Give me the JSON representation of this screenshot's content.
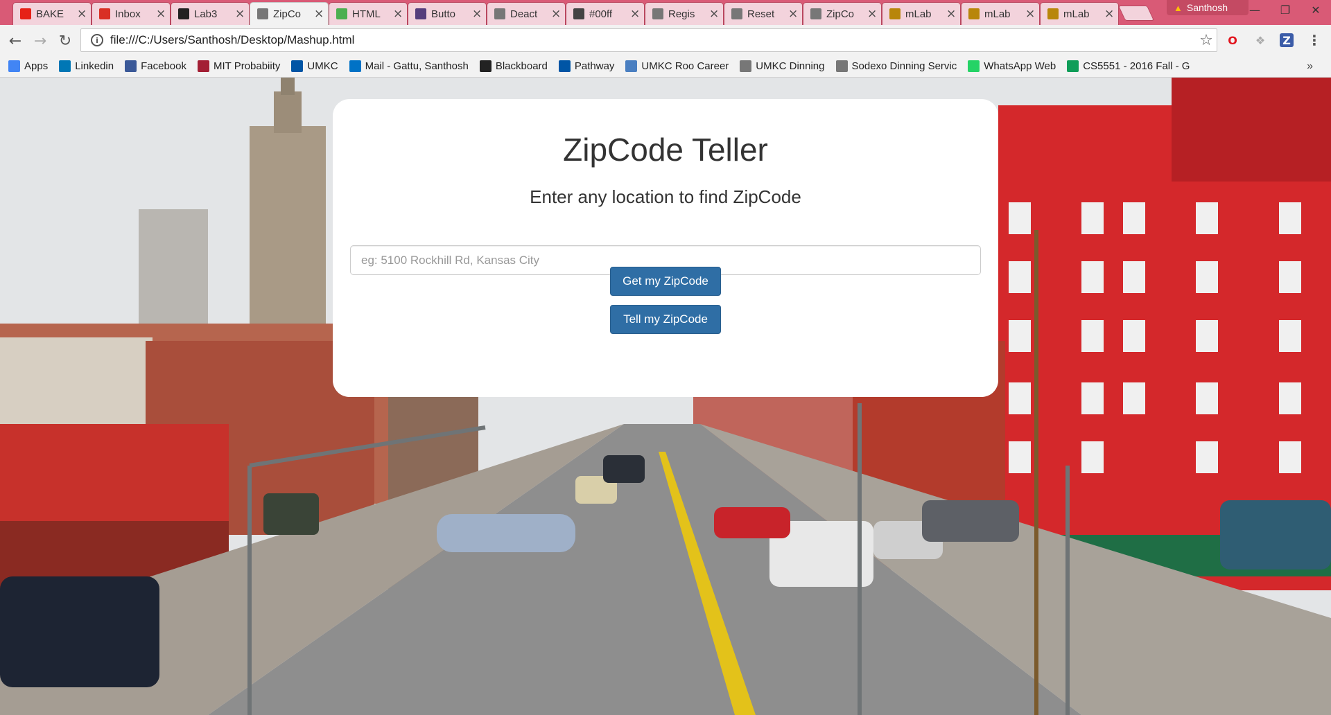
{
  "browser": {
    "tabs": [
      {
        "title": "BAKE",
        "favicon": "youtube-icon",
        "color": "#e62117"
      },
      {
        "title": "Inbox",
        "favicon": "gmail-icon",
        "color": "#d93025"
      },
      {
        "title": "Lab3",
        "favicon": "github-icon",
        "color": "#222222"
      },
      {
        "title": "ZipCo",
        "favicon": "page-icon",
        "color": "#777777",
        "active": true
      },
      {
        "title": "HTML",
        "favicon": "w3schools-icon",
        "color": "#4caf50"
      },
      {
        "title": "Butto",
        "favicon": "bootstrap-icon",
        "color": "#563d7c"
      },
      {
        "title": "Deact",
        "favicon": "page-icon",
        "color": "#777777"
      },
      {
        "title": "#00ff",
        "favicon": "color-icon",
        "color": "#444444"
      },
      {
        "title": "Regis",
        "favicon": "page-icon",
        "color": "#777777"
      },
      {
        "title": "Reset",
        "favicon": "page-icon",
        "color": "#777777"
      },
      {
        "title": "ZipCo",
        "favicon": "page-icon",
        "color": "#777777"
      },
      {
        "title": "mLab",
        "favicon": "mlab-icon",
        "color": "#b8860b"
      },
      {
        "title": "mLab",
        "favicon": "mlab-icon",
        "color": "#b8860b"
      },
      {
        "title": "mLab",
        "favicon": "mlab-icon",
        "color": "#b8860b"
      }
    ],
    "profile_name": "Santhosh",
    "url": "file:///C:/Users/Santhosh/Desktop/Mashup.html",
    "accent_color": "#d95a76"
  },
  "bookmarks": [
    {
      "label": "Apps",
      "icon": "apps-grid-icon",
      "color": "#4285f4"
    },
    {
      "label": "Linkedin",
      "icon": "linkedin-icon",
      "color": "#0077b5"
    },
    {
      "label": "Facebook",
      "icon": "facebook-icon",
      "color": "#3b5998"
    },
    {
      "label": "MIT Probabiity",
      "icon": "mit-ocw-icon",
      "color": "#a31f34"
    },
    {
      "label": "UMKC",
      "icon": "umkc-icon",
      "color": "#0055a5"
    },
    {
      "label": "Mail - Gattu, Santhosh",
      "icon": "outlook-icon",
      "color": "#0072c6"
    },
    {
      "label": "Blackboard",
      "icon": "blackboard-icon",
      "color": "#222222"
    },
    {
      "label": "Pathway",
      "icon": "umkc-icon",
      "color": "#0055a5"
    },
    {
      "label": "UMKC Roo Career",
      "icon": "roo-career-icon",
      "color": "#4a7fc1"
    },
    {
      "label": "UMKC Dinning",
      "icon": "page-icon",
      "color": "#777777"
    },
    {
      "label": "Sodexo Dinning Servic",
      "icon": "page-icon",
      "color": "#777777"
    },
    {
      "label": "WhatsApp Web",
      "icon": "whatsapp-icon",
      "color": "#25d366"
    },
    {
      "label": "CS5551 - 2016 Fall - G",
      "icon": "sheets-icon",
      "color": "#0f9d58"
    }
  ],
  "card": {
    "title": "ZipCode Teller",
    "subtitle": "Enter any location to find ZipCode",
    "input_placeholder": "eg: 5100 Rockhill Rd, Kansas City",
    "input_value": "",
    "get_button": "Get my ZipCode",
    "tell_button": "Tell my ZipCode"
  }
}
